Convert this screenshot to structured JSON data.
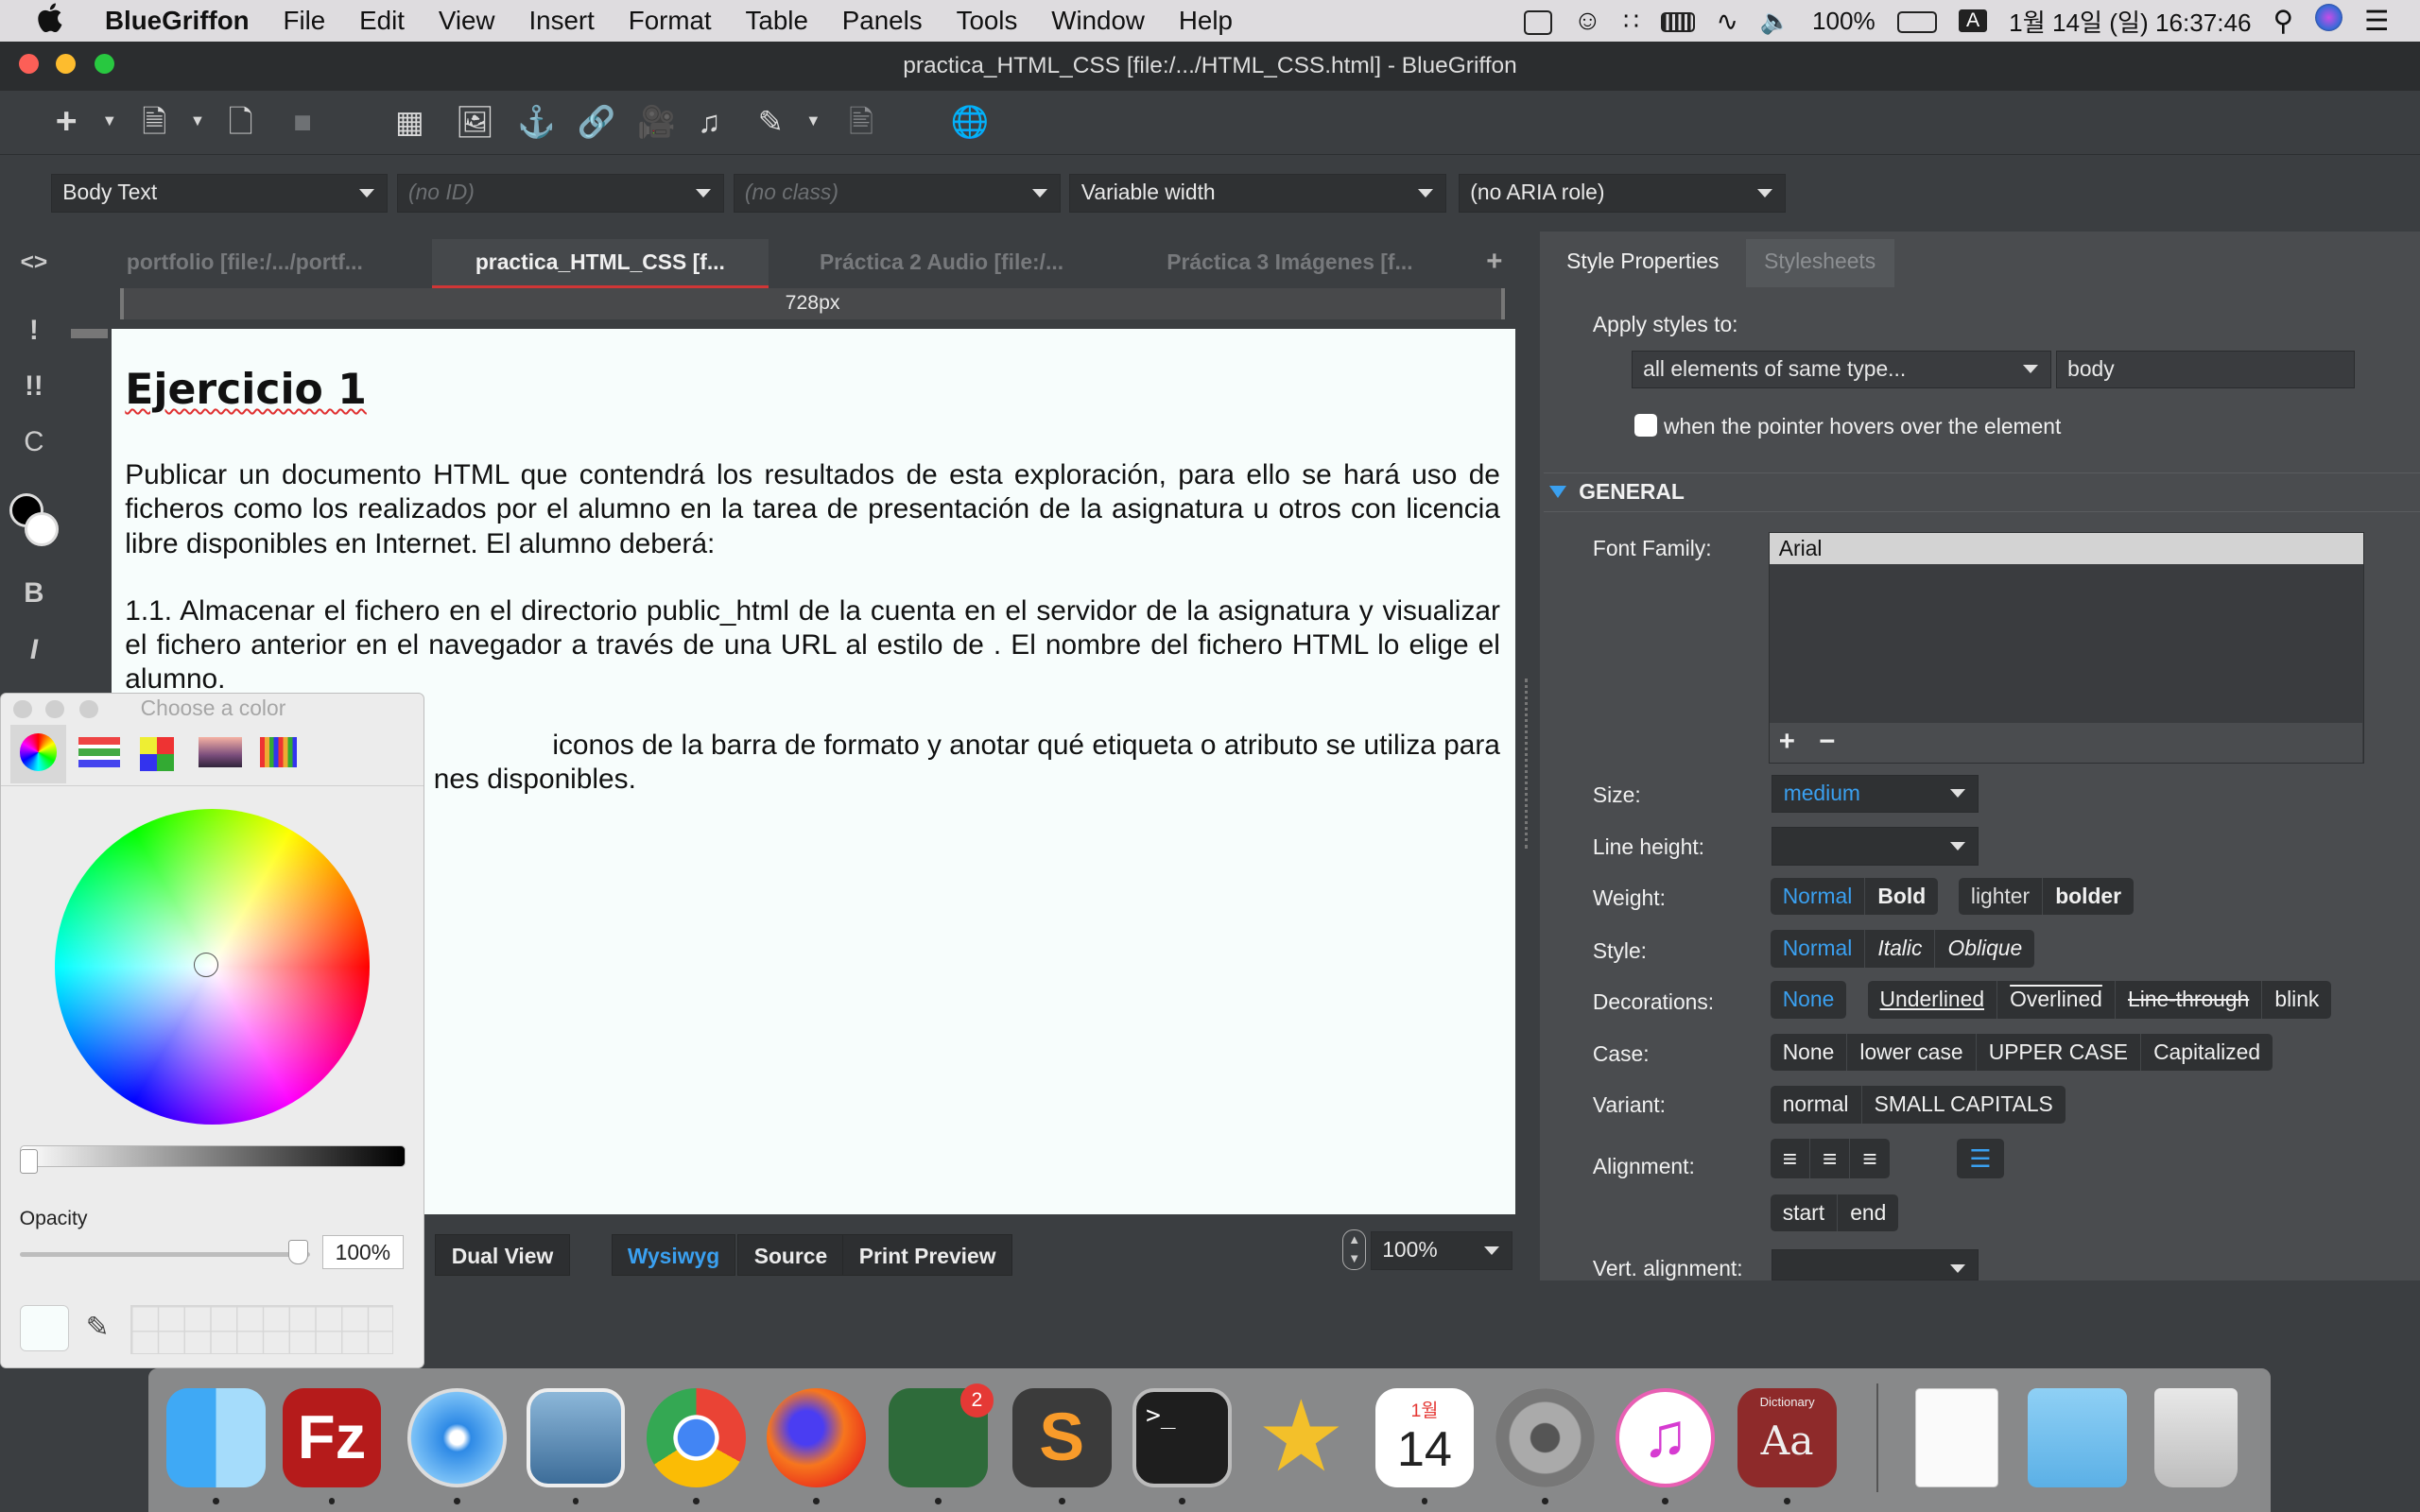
{
  "menubar": {
    "apple": "",
    "app": "BlueGriffon",
    "items": [
      "File",
      "Edit",
      "View",
      "Insert",
      "Format",
      "Table",
      "Panels",
      "Tools",
      "Window",
      "Help"
    ],
    "battery": "100%",
    "input_source": "A",
    "datetime": "1월 14일 (일)  16:37:46"
  },
  "window": {
    "title": "practica_HTML_CSS [file:/.../HTML_CSS.html] - BlueGriffon"
  },
  "format_bar": {
    "paragraph": "Body Text",
    "id": "(no ID)",
    "class": "(no class)",
    "width": "Variable width",
    "aria": "(no ARIA role)"
  },
  "side_strip": {
    "code": "<>",
    "important": "!",
    "important2": "!!",
    "c": "C",
    "bold": "B",
    "italic": "I"
  },
  "tabs": [
    {
      "label": "portfolio [file:/.../portf..."
    },
    {
      "label": "practica_HTML_CSS [f..."
    },
    {
      "label": "Práctica 2 Audio [file:/..."
    },
    {
      "label": "Práctica 3 Imágenes [f..."
    }
  ],
  "tabs_add": "+",
  "ruler": "728px",
  "document": {
    "heading": "Ejercicio 1",
    "p1": "Publicar un documento HTML que contendrá los resultados de esta exploración, para ello se hará uso de ficheros como los realizados por el alumno en la tarea de presentación de la asignatura u otros con licencia libre disponibles en Internet. El alumno deberá:",
    "p2": "1.1. Almacenar el fichero en el directorio public_html de la cuenta en el servidor de la asignatura y visualizar el fichero anterior en el navegador a través de una URL al estilo de . El nombre del fichero HTML lo elige el alumno.",
    "p3a": "iconos de la barra de formato y anotar qué etiqueta o atributo se utiliza para",
    "p3b": "nes disponibles."
  },
  "view_bar": {
    "dual": "Dual View",
    "wysiwyg": "Wysiwyg",
    "source": "Source",
    "preview": "Print Preview",
    "zoom": "100%"
  },
  "style_panel": {
    "tab_props": "Style Properties",
    "tab_sheets": "Stylesheets",
    "apply_label": "Apply styles to:",
    "apply_value": "all elements of same type...",
    "element": "body",
    "hover_label": "when the pointer hovers over the element",
    "section": "GENERAL",
    "font_family_label": "Font Family:",
    "font_family": "Arial",
    "add": "+",
    "remove": "−",
    "size_label": "Size:",
    "size": "medium",
    "line_height_label": "Line height:",
    "weight_label": "Weight:",
    "weight": [
      "Normal",
      "Bold"
    ],
    "weight2": [
      "lighter",
      "bolder"
    ],
    "style_label": "Style:",
    "style": [
      "Normal",
      "Italic",
      "Oblique"
    ],
    "decorations_label": "Decorations:",
    "decor_none": "None",
    "decorations": [
      "Underlined",
      "Overlined",
      "Line-through",
      "blink"
    ],
    "case_label": "Case:",
    "case": [
      "None",
      "lower case",
      "UPPER CASE",
      "Capitalized"
    ],
    "variant_label": "Variant:",
    "variant": [
      "normal",
      "SMALL CAPITALS"
    ],
    "alignment_label": "Alignment:",
    "align2": [
      "start",
      "end"
    ],
    "valign_label": "Vert. alignment:"
  },
  "color_window": {
    "title": "Choose a color",
    "opacity_label": "Opacity",
    "opacity": "100%"
  },
  "dock": {
    "filezilla_badge": "2",
    "calendar_month": "1월",
    "calendar_day": "14",
    "dictionary": "Dictionary",
    "dict_glyph": "Aa"
  }
}
